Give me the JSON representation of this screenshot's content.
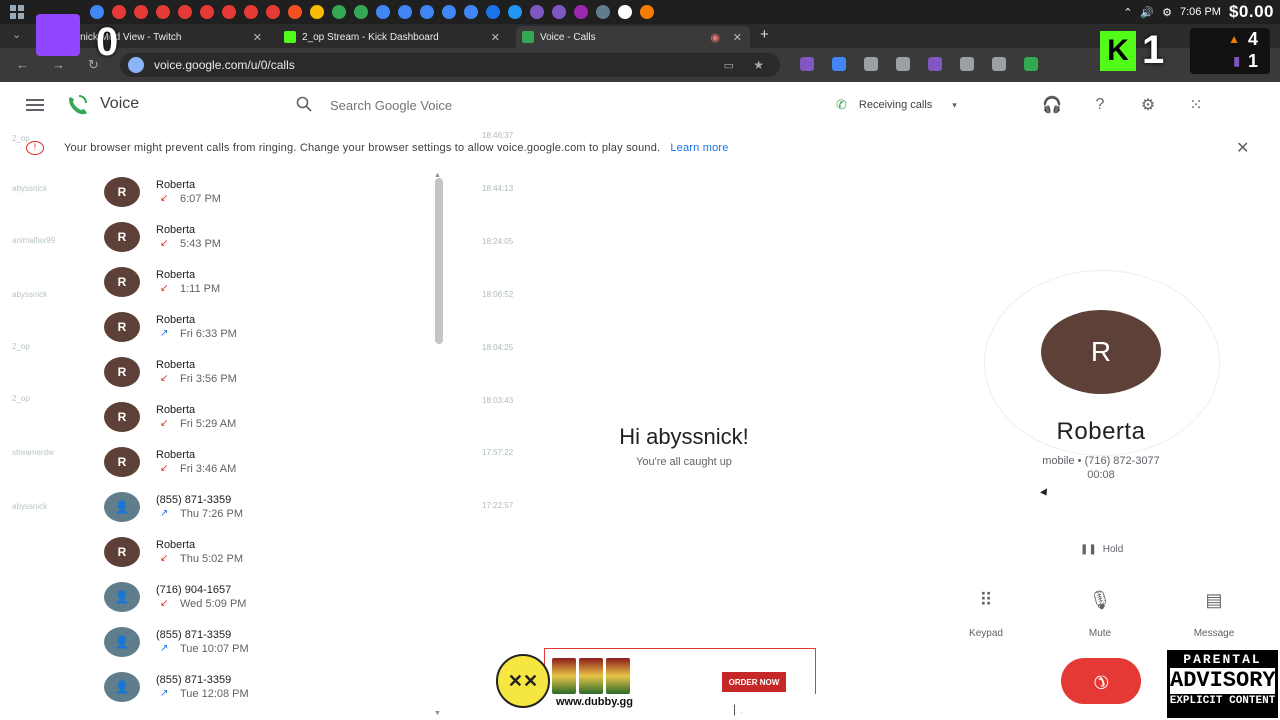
{
  "taskbar": {
    "time": "7:06 PM",
    "overlay_money": "$0.00",
    "colors": [
      "#4285f4",
      "#e53935",
      "#e53935",
      "#e53935",
      "#e53935",
      "#e53935",
      "#e53935",
      "#e53935",
      "#e53935",
      "#f4511e",
      "#fbbc04",
      "#34a853",
      "#34a853",
      "#4285f4",
      "#4285f4",
      "#4285f4",
      "#4285f4",
      "#4285f4",
      "#1a73e8",
      "#2196f3",
      "#7e57c2",
      "#7e57c2",
      "#9c27b0",
      "#607d8b",
      "#ffffff",
      "#f57c00"
    ]
  },
  "overlays": {
    "twitch_count": "0",
    "kick_logo": "K",
    "kick_count": "1",
    "stats": [
      "4",
      "1"
    ]
  },
  "tabs": [
    {
      "label": "abyssnick Mod View - Twitch",
      "favicon_color": "#9146ff",
      "active": false
    },
    {
      "label": "2_op Stream - Kick Dashboard",
      "favicon_color": "#53fc18",
      "active": false
    },
    {
      "label": "Voice - Calls",
      "favicon_color": "#34a853",
      "active": true
    }
  ],
  "address": {
    "url": "voice.google.com/u/0/calls"
  },
  "header": {
    "title": "Voice",
    "search_placeholder": "Search Google Voice",
    "receiving": "Receiving calls"
  },
  "banner": {
    "text": "Your browser might prevent calls from ringing. Change your browser settings to allow voice.google.com to play sound.",
    "link": "Learn more"
  },
  "calls": [
    {
      "initial": "R",
      "name": "Roberta",
      "time": "6:07 PM",
      "direction": "missed",
      "avatar": "brown"
    },
    {
      "initial": "R",
      "name": "Roberta",
      "time": "5:43 PM",
      "direction": "missed",
      "avatar": "brown"
    },
    {
      "initial": "R",
      "name": "Roberta",
      "time": "1:11 PM",
      "direction": "missed",
      "avatar": "brown"
    },
    {
      "initial": "R",
      "name": "Roberta",
      "time": "Fri 6:33 PM",
      "direction": "outgoing",
      "avatar": "brown"
    },
    {
      "initial": "R",
      "name": "Roberta",
      "time": "Fri 3:56 PM",
      "direction": "missed",
      "avatar": "brown"
    },
    {
      "initial": "R",
      "name": "Roberta",
      "time": "Fri 5:29 AM",
      "direction": "missed",
      "avatar": "brown"
    },
    {
      "initial": "R",
      "name": "Roberta",
      "time": "Fri 3:46 AM",
      "direction": "missed",
      "avatar": "brown"
    },
    {
      "initial": "",
      "name": "(855) 871-3359",
      "time": "Thu 7:26 PM",
      "direction": "outgoing",
      "avatar": "gray"
    },
    {
      "initial": "R",
      "name": "Roberta",
      "time": "Thu 5:02 PM",
      "direction": "missed",
      "avatar": "brown"
    },
    {
      "initial": "",
      "name": "(716) 904-1657",
      "time": "Wed 5:09 PM",
      "direction": "missed",
      "avatar": "gray"
    },
    {
      "initial": "",
      "name": "(855) 871-3359",
      "time": "Tue 10:07 PM",
      "direction": "outgoing",
      "avatar": "gray"
    },
    {
      "initial": "",
      "name": "(855) 871-3359",
      "time": "Tue 12:08 PM",
      "direction": "outgoing",
      "avatar": "gray"
    }
  ],
  "chat_overlay": {
    "users": [
      "2_op",
      "abyssnick",
      "animalfax99",
      "abyssnick",
      "2_op",
      "2_op",
      "streamerdw",
      "abyssnick"
    ],
    "timestamps": [
      "18:46:37",
      "18:44:13",
      "18:24:05",
      "18:06:52",
      "18:04:25",
      "18:03:43",
      "17:57:22",
      "17:22:57"
    ]
  },
  "center": {
    "greeting": "Hi abyssnick!",
    "subtext": "You're all caught up"
  },
  "active_call": {
    "initial": "R",
    "name": "Roberta",
    "number": "mobile • (716) 872-3077",
    "timer": "00:08",
    "hold_label": "Hold",
    "keypad_label": "Keypad",
    "mute_label": "Mute",
    "message_label": "Message"
  },
  "ad": {
    "url": "www.dubby.gg",
    "cta": "ORDER NOW"
  },
  "advisory": {
    "line1": "PARENTAL",
    "line2": "ADVISORY",
    "line3": "EXPLICIT CONTENT"
  }
}
